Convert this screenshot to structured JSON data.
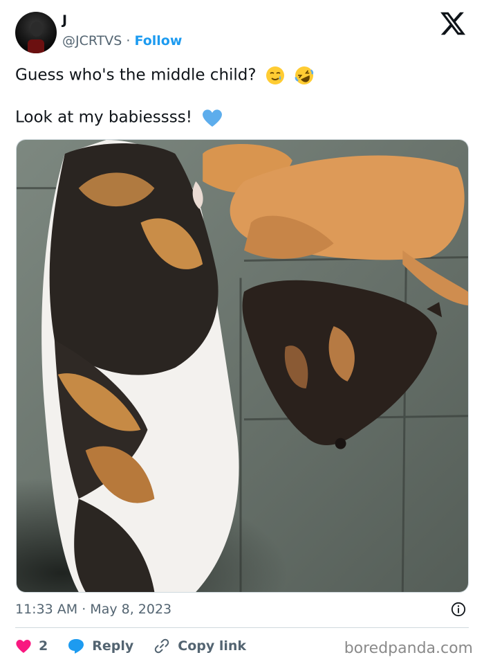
{
  "author": {
    "name": "J",
    "handle": "@JCRTVS",
    "separator": "·",
    "follow_label": "Follow"
  },
  "tweet": {
    "line1": "Guess who's the middle child?",
    "line2": "Look at my babiessss!",
    "line1_emojis": [
      "smiling-face-with-tear-icon",
      "rolling-on-floor-laughing-icon"
    ],
    "line2_emojis": [
      "blue-heart-icon"
    ]
  },
  "meta": {
    "timestamp": "11:33 AM · May 8, 2023"
  },
  "actions": {
    "like_count": "2",
    "reply_label": "Reply",
    "copy_label": "Copy link"
  },
  "watermark": "boredpanda.com",
  "colors": {
    "accent": "#1d9bf0",
    "like": "#f91880",
    "secondary_text": "#536471"
  }
}
